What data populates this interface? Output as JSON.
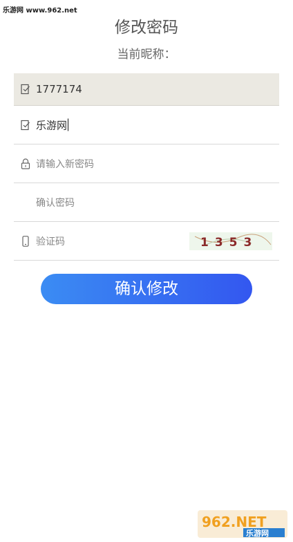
{
  "watermark_top": "乐游网 www.962.net",
  "title": "修改密码",
  "nickname_label": "当前昵称：",
  "form": {
    "account_value": "1777174",
    "nickname_value": "乐游网",
    "new_password_placeholder": "请输入新密码",
    "confirm_password_placeholder": "确认密码",
    "captcha_placeholder": "验证码",
    "captcha_text": "1353"
  },
  "submit_label": "确认修改",
  "watermark_logo": {
    "brand": "962.NET",
    "sub": "乐游网"
  },
  "colors": {
    "button_start": "#3b8cf3",
    "button_end": "#3357f0",
    "account_bg": "#ebe9e2",
    "captcha_text": "#8b2a2a"
  },
  "icons": {
    "account": "edit-icon",
    "nickname": "edit-icon",
    "password": "lock-icon",
    "captcha": "phone-icon"
  }
}
